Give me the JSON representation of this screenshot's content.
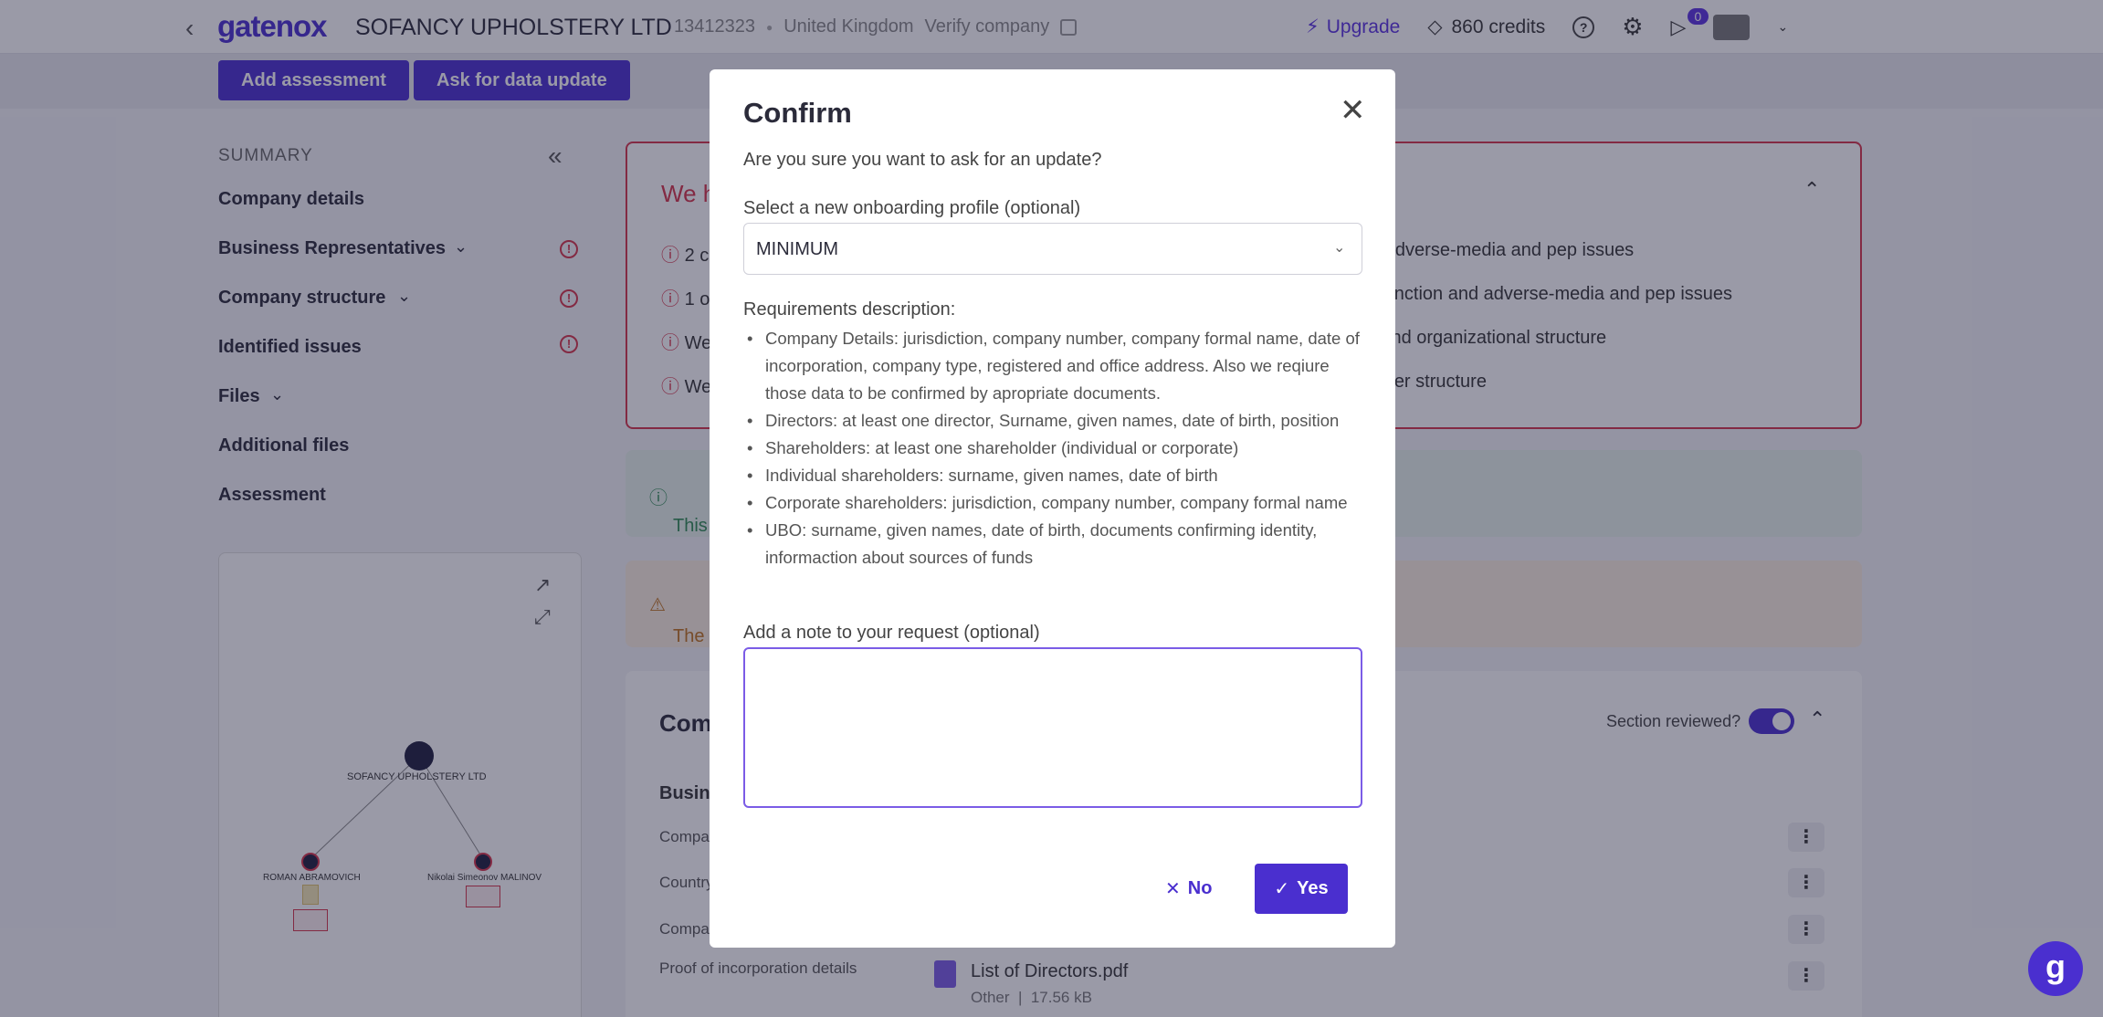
{
  "header": {
    "logo": "gatenox",
    "company_name": "SOFANCY UPHOLSTERY LTD",
    "company_number": "13412323",
    "country": "United Kingdom",
    "verify_label": "Verify company",
    "upgrade_label": "Upgrade",
    "credits_label": "860 credits",
    "notifications_count": "0"
  },
  "actions": {
    "add_assessment": "Add assessment",
    "ask_update": "Ask for data update"
  },
  "sidebar": {
    "title": "SUMMARY",
    "items": [
      {
        "label": "Company details"
      },
      {
        "label": "Business Representatives"
      },
      {
        "label": "Company structure"
      },
      {
        "label": "Identified issues"
      },
      {
        "label": "Files"
      },
      {
        "label": "Additional files"
      },
      {
        "label": "Assessment"
      }
    ]
  },
  "graph": {
    "root": "SOFANCY UPHOLSTERY LTD",
    "left": "ROMAN ABRAMOVICH",
    "right": "Nikolai Simeonov MALINOV"
  },
  "issues": {
    "title_partial": "We h",
    "lines_left": [
      "2 c",
      "1 o",
      "We",
      "We"
    ],
    "lines_right": [
      "nd adverse-media and pep issues",
      "d sanction and adverse-media and pep issues",
      "er and organizational structure",
      "holder structure"
    ]
  },
  "info_partial": "This",
  "warning_partial": "The",
  "company_section": {
    "title_partial": "Com",
    "reviewed_label": "Section reviewed?",
    "subheading_partial": "Busin",
    "rows": [
      "Compa",
      "Country",
      "Compa",
      "Proof of incorporation details"
    ],
    "file_name": "List of Directors.pdf",
    "file_type": "Other",
    "file_size": "17.56 kB"
  },
  "modal": {
    "title": "Confirm",
    "question": "Are you sure you want to ask for an update?",
    "select_label": "Select a new onboarding profile (optional)",
    "select_value": "MINIMUM",
    "requirements_title": "Requirements description:",
    "requirements": [
      "Company Details: jurisdiction, company number, company formal name, date of incorporation, company type, registered and office address. Also we reqiure those data to be confirmed by apropriate documents.",
      "Directors: at least one director, Surname, given names, date of birth, position",
      "Shareholders: at least one shareholder (individual or corporate)",
      "Individual shareholders: surname, given names, date of birth",
      "Corporate shareholders: jurisdiction, company number, company formal name",
      "UBO: surname, given names, date of birth, documents confirming identity, informaction about sources of funds"
    ],
    "note_label": "Add a note to your request (optional)",
    "note_value": "",
    "no_label": "No",
    "yes_label": "Yes"
  },
  "colors": {
    "brand": "#4a2fcf",
    "danger": "#d6344a",
    "success": "#2f8a53",
    "warning": "#c0721c"
  }
}
